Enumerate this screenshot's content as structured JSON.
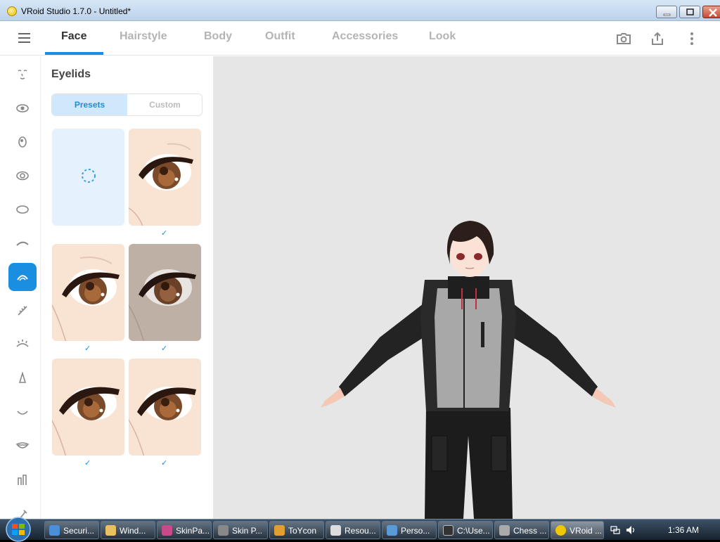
{
  "window": {
    "title": "VRoid Studio 1.7.0 - Untitled*"
  },
  "header": {
    "tabs": [
      {
        "label": "Face"
      },
      {
        "label": "Hairstyle"
      },
      {
        "label": "Body"
      },
      {
        "label": "Outfit"
      },
      {
        "label": "Accessories"
      },
      {
        "label": "Look"
      }
    ],
    "active_tab": "Face",
    "icons": [
      "camera-icon",
      "export-icon",
      "more-vertical-icon"
    ]
  },
  "rail": {
    "items": [
      "face-overview-icon",
      "eye-icon",
      "iris-icon",
      "eye-highlight-icon",
      "eye-white-icon",
      "eyebrow-icon",
      "eyelid-icon",
      "eyelash-icon",
      "eye-line-icon",
      "nose-icon",
      "mouth-icon",
      "teeth-icon",
      "ear-icon",
      "more-icon"
    ],
    "active": "eyelid-icon"
  },
  "panel": {
    "title": "Eyelids",
    "segments": {
      "presets": "Presets",
      "custom": "Custom"
    },
    "active_segment": "Presets",
    "presets": [
      {
        "type": "blank",
        "checked": false
      },
      {
        "type": "eye",
        "skin": "light",
        "checked": true
      },
      {
        "type": "eye",
        "skin": "light",
        "checked": true
      },
      {
        "type": "eye",
        "skin": "dark",
        "checked": true
      },
      {
        "type": "eye",
        "skin": "light",
        "checked": true
      },
      {
        "type": "eye",
        "skin": "light",
        "checked": true
      }
    ]
  },
  "taskbar": {
    "items": [
      {
        "label": "Securi...",
        "color": "#4a8fd8"
      },
      {
        "label": "Wind...",
        "color": "#e8c060"
      },
      {
        "label": "SkinPa...",
        "color": "#c84a8a"
      },
      {
        "label": "Skin P...",
        "color": "#888888"
      },
      {
        "label": "ToYcon",
        "color": "#e0a030"
      },
      {
        "label": "Resou...",
        "color": "#dddddd"
      },
      {
        "label": "Perso...",
        "color": "#5a9ad8"
      },
      {
        "label": "C:\\Use...",
        "color": "#333333"
      },
      {
        "label": "Chess ...",
        "color": "#aaaaaa"
      },
      {
        "label": "VRoid ...",
        "color": "#f0c800"
      }
    ],
    "clock": "1:36 AM"
  }
}
